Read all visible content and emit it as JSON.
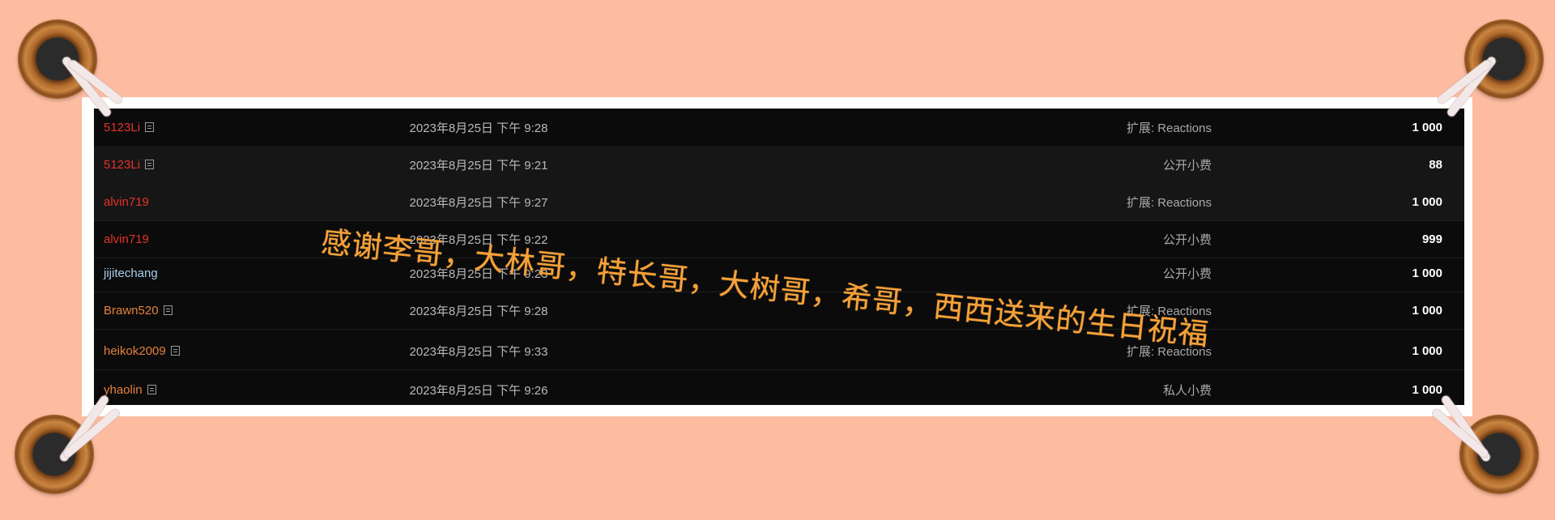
{
  "transactions": [
    {
      "user": "5123Li",
      "user_color": "#e6322b",
      "has_note": true,
      "date": "2023年8月25日 下午 9:28",
      "type": "扩展: Reactions",
      "amount": "1 000"
    },
    {
      "user": "5123Li",
      "user_color": "#e6322b",
      "has_note": true,
      "date": "2023年8月25日 下午 9:21",
      "type": "公开小费",
      "amount": "88"
    },
    {
      "user": "alvin719",
      "user_color": "#e6322b",
      "has_note": false,
      "date": "2023年8月25日 下午 9:27",
      "type": "扩展: Reactions",
      "amount": "1 000"
    },
    {
      "user": "alvin719",
      "user_color": "#e6322b",
      "has_note": false,
      "date": "2023年8月25日 下午 9:22",
      "type": "公开小费",
      "amount": "999"
    },
    {
      "user": "jijitechang",
      "user_color": "#a9cbe8",
      "has_note": false,
      "date": "2023年8月25日 下午 9:23",
      "type": "公开小费",
      "amount": "1 000"
    },
    {
      "user": "Brawn520",
      "user_color": "#e5803a",
      "has_note": true,
      "date": "2023年8月25日 下午 9:28",
      "type": "扩展: Reactions",
      "amount": "1 000"
    },
    {
      "user": "heikok2009",
      "user_color": "#e5803a",
      "has_note": true,
      "date": "2023年8月25日 下午 9:33",
      "type": "扩展: Reactions",
      "amount": "1 000"
    },
    {
      "user": "yhaolin",
      "user_color": "#e5803a",
      "has_note": true,
      "date": "2023年8月25日 下午 9:26",
      "type": "私人小费",
      "amount": "1 000"
    }
  ],
  "overlay_text": "感谢李哥，大林哥，特长哥，大树哥，希哥，西西送来的生日祝福",
  "colors": {
    "background": "#fdbba0",
    "overlay_text": "#f5a13a",
    "table_bg": "#0b0b0b"
  }
}
